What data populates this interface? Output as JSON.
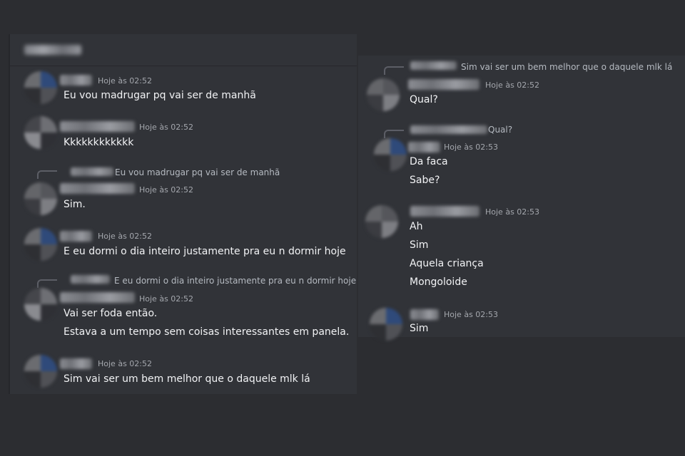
{
  "left": {
    "messages": [
      {
        "time": "Hoje às 02:52",
        "text": "Eu vou madrugar pq vai ser de manhã"
      },
      {
        "time": "Hoje às 02:52",
        "text": "Kkkkkkkkkkkk"
      },
      {
        "time": "Hoje às 02:52",
        "reply": "Eu vou madrugar pq vai ser de manhã",
        "text": "Sim."
      },
      {
        "time": "Hoje às 02:52",
        "text": "E eu dormi o dia inteiro justamente pra eu n dormir hoje"
      },
      {
        "time": "Hoje às 02:52",
        "reply": "E eu dormi o dia inteiro justamente pra eu n dormir hoje",
        "text": "Vai ser foda então.",
        "text2": "Estava a um tempo sem coisas interessantes em panela."
      },
      {
        "time": "Hoje às 02:52",
        "text": "Sim vai ser um bem melhor que o daquele mlk lá"
      }
    ]
  },
  "right": {
    "messages": [
      {
        "time": "Hoje às 02:52",
        "reply": "Sim vai ser um bem melhor que o daquele mlk lá",
        "text": "Qual?"
      },
      {
        "time": "Hoje às 02:53",
        "reply": "Qual?",
        "text": "Da faca",
        "text2": "Sabe?"
      },
      {
        "time": "Hoje às 02:53",
        "text": "Ah",
        "text2": "Sim",
        "text3": "Aquela criança",
        "text4": "Mongoloide"
      },
      {
        "time": "Hoje às 02:53",
        "text": "Sim"
      }
    ]
  }
}
